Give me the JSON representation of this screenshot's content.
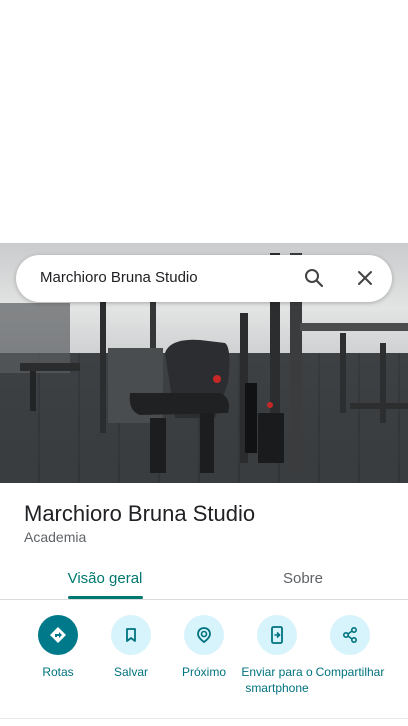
{
  "search": {
    "query": "Marchioro Bruna Studio",
    "search_icon": "search-icon",
    "close_icon": "close-icon"
  },
  "place": {
    "name": "Marchioro Bruna Studio",
    "category": "Academia",
    "photo": "gym-photo"
  },
  "tabs": [
    {
      "label": "Visão geral",
      "active": true
    },
    {
      "label": "Sobre",
      "active": false
    }
  ],
  "actions": [
    {
      "label": "Rotas",
      "icon": "directions-icon"
    },
    {
      "label": "Salvar",
      "icon": "bookmark-icon"
    },
    {
      "label": "Próximo",
      "icon": "nearby-icon"
    },
    {
      "label": "Enviar para o smartphone",
      "icon": "send-to-phone-icon"
    },
    {
      "label": "Compartilhar",
      "icon": "share-icon"
    }
  ],
  "colors": {
    "accent": "#00786f",
    "action_bg": "#d7f3fb",
    "primary_action_bg": "#00798a"
  }
}
